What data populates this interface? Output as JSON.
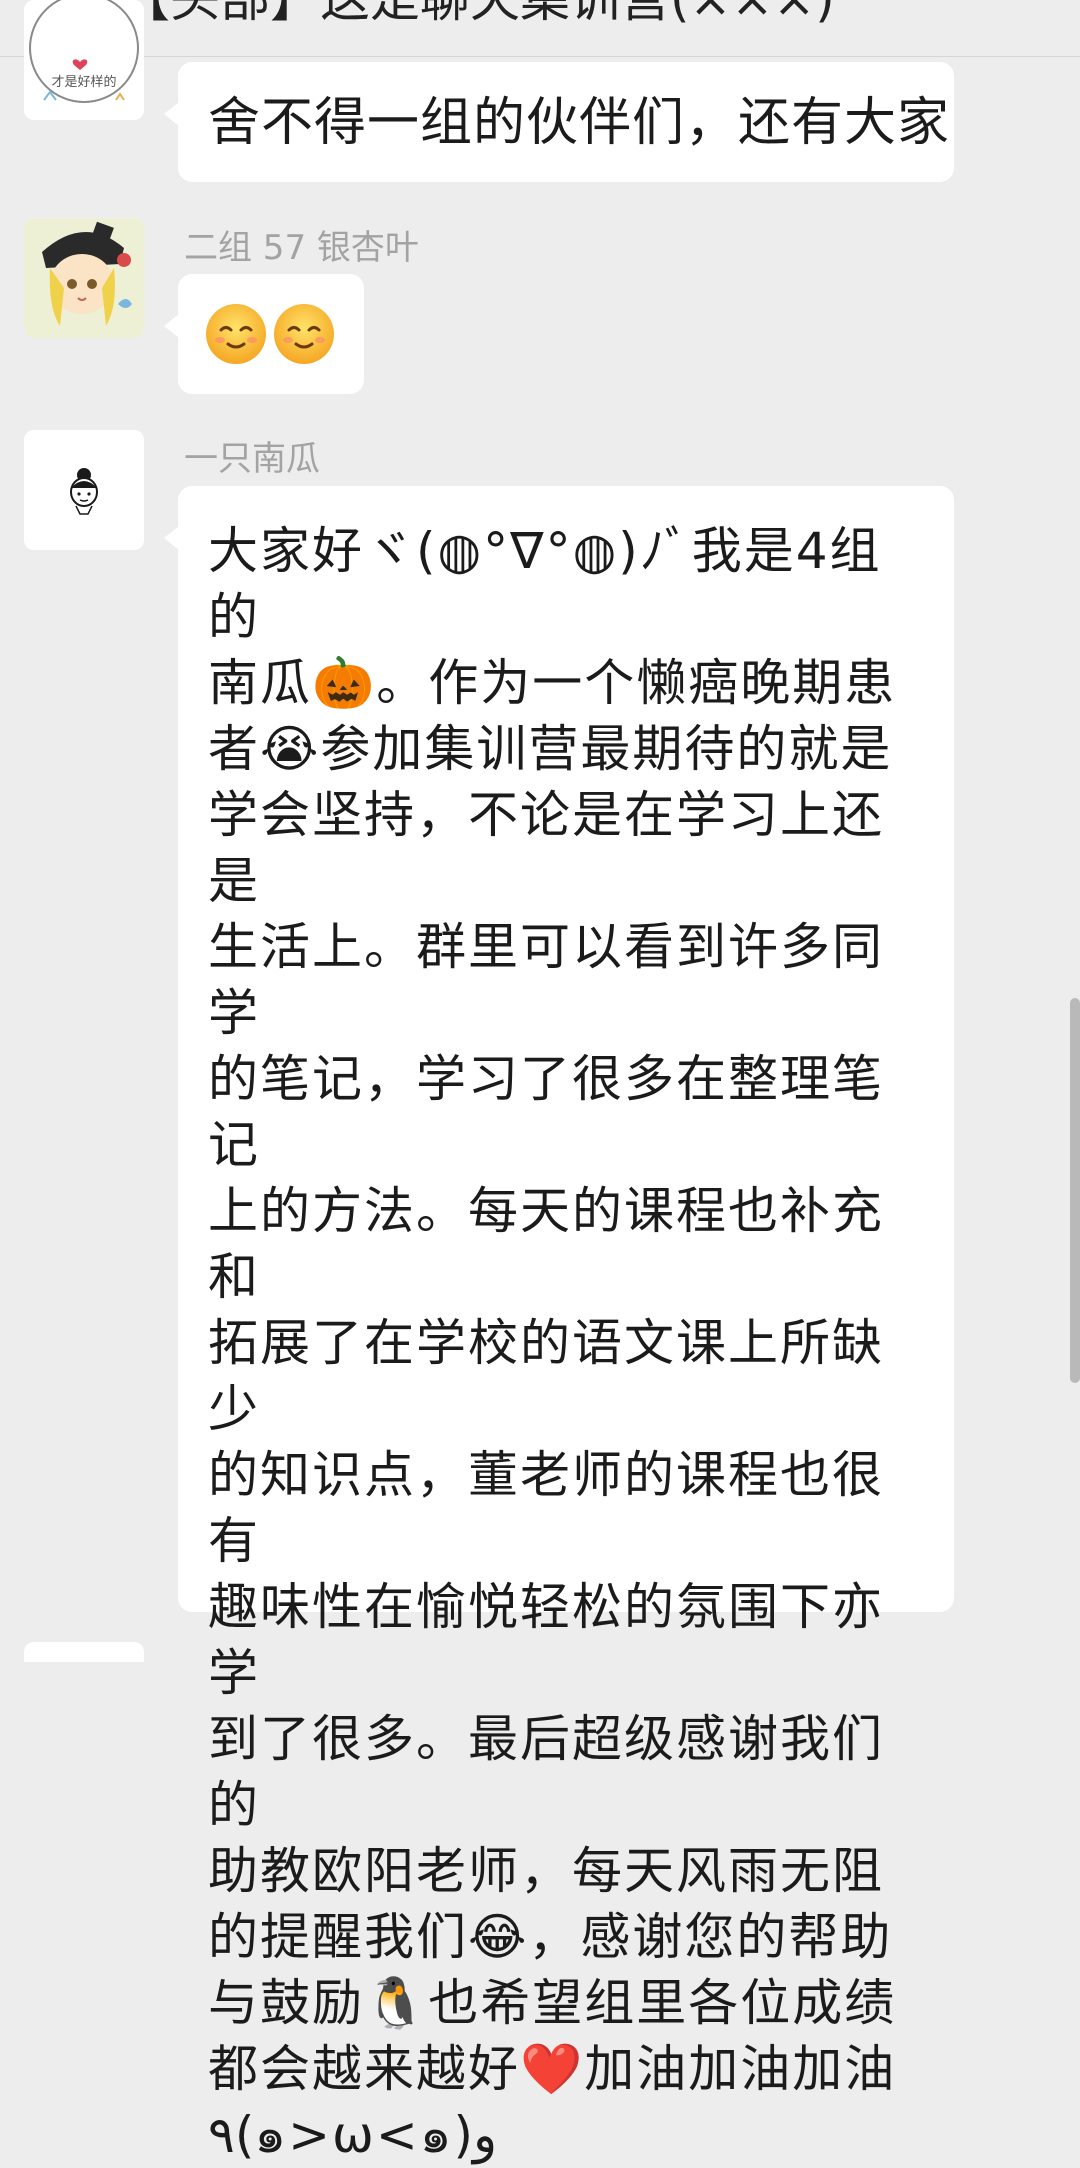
{
  "header": {
    "back_icon": "chevron-left-icon",
    "title": "【头部】这是聊天集训营(×××)",
    "more_icon": "more-icon"
  },
  "messages": [
    {
      "sender": "",
      "avatar_caption": "才是好样的",
      "text": "舍不得一组的伙伴们，还有大家"
    },
    {
      "sender": "二组 57 银杏叶",
      "emojis": [
        "smiling-face-icon",
        "smiling-face-icon"
      ]
    },
    {
      "sender": "一只南瓜",
      "text": "大家好ヾ(◍°∇°◍)ﾉﾞ我是4组的\n南瓜🎃。作为一个懒癌晚期患\n者😭参加集训营最期待的就是\n学会坚持，不论是在学习上还是\n生活上。群里可以看到许多同学\n的笔记，学习了很多在整理笔记\n上的方法。每天的课程也补充和\n拓展了在学校的语文课上所缺少\n的知识点，董老师的课程也很有\n趣味性在愉悦轻松的氛围下亦学\n到了很多。最后超级感谢我们的\n助教欧阳老师，每天风雨无阻\n的提醒我们😂，感谢您的帮助\n与鼓励🐧也希望组里各位成绩\n都会越来越好❤️加油加油加油\n٩(๑>ω<๑)و"
    }
  ],
  "colors": {
    "background": "#ededed",
    "bubble": "#ffffff",
    "sender_name": "#a3a3a3"
  }
}
